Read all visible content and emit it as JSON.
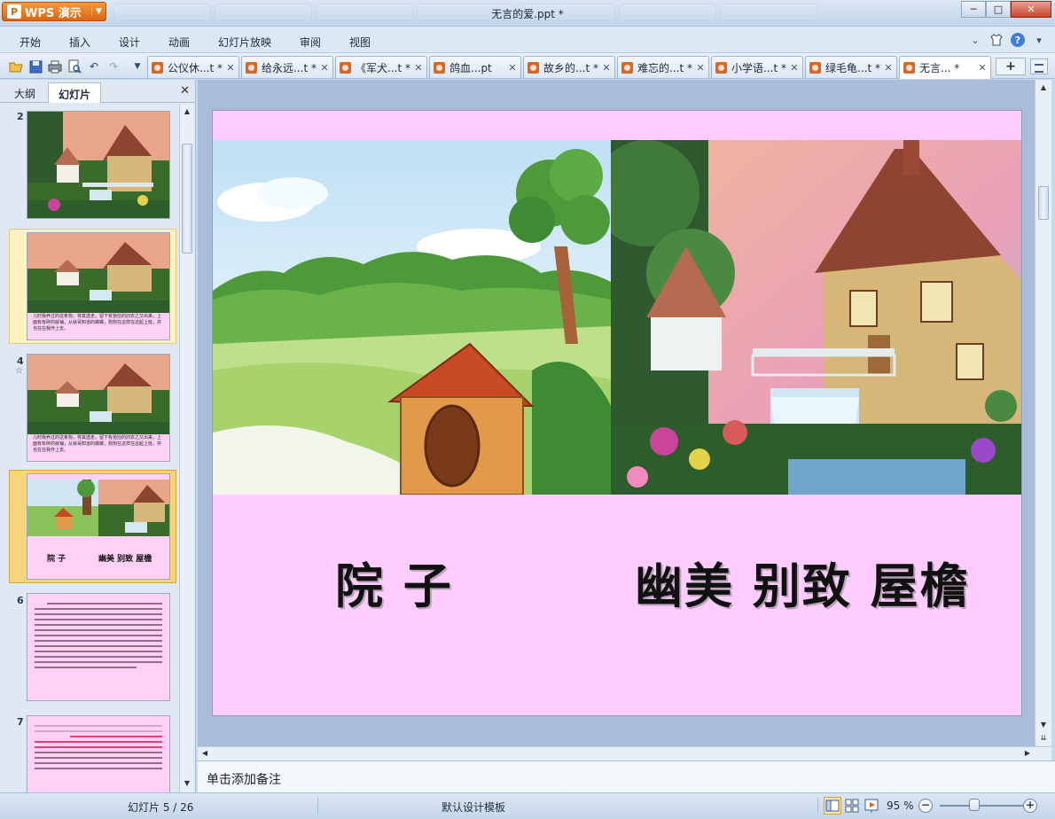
{
  "window": {
    "app_button_label": "WPS 演示",
    "title": "无言的爱.ppt *",
    "minimize": "─",
    "maximize": "□",
    "close": "✕"
  },
  "menu": {
    "items": [
      "开始",
      "插入",
      "设计",
      "动画",
      "幻灯片放映",
      "审阅",
      "视图"
    ]
  },
  "doc_tabs": [
    {
      "label": "公仪休...t *",
      "close": "✕"
    },
    {
      "label": "给永远...t *",
      "close": "✕"
    },
    {
      "label": "《军犬...t *",
      "close": "✕"
    },
    {
      "label": "鸽血...pt",
      "close": "✕"
    },
    {
      "label": "故乡的...t *",
      "close": "✕"
    },
    {
      "label": "难忘的...t *",
      "close": "✕"
    },
    {
      "label": "小学语...t *",
      "close": "✕"
    },
    {
      "label": "绿毛龟...t *",
      "close": "✕"
    },
    {
      "label": "无言... *",
      "close": "✕"
    }
  ],
  "new_tab": "+",
  "left_pane": {
    "tab_outline": "大纲",
    "tab_slides": "幻灯片",
    "close": "✕",
    "thumbnails": [
      {
        "num": "2"
      },
      {
        "num": "3",
        "text": "儿时我养过的这条狗，将其送走，留下有拾捡的旧衣之又出来，上面有有碎的就铺，从就哥知道的蝶蝶，狗狗在这样在这起上班，并也在在我作上去。"
      },
      {
        "num": "4",
        "star": "☆",
        "text": "儿时我养过的这条狗，将其送走，留下有拾捡的旧衣之又出来，上面有有碎的就铺，从就哥知道的蝶蝶，狗狗在这样在这起上班，并也在在我作上去。"
      },
      {
        "num": "5",
        "cap_left": "院 子",
        "cap_right": "幽美 别致 屋檐"
      },
      {
        "num": "6"
      },
      {
        "num": "7"
      }
    ]
  },
  "slide": {
    "caption_left": "院 子",
    "caption_right": "幽美  别致  屋檐"
  },
  "notes_placeholder": "单击添加备注",
  "status": {
    "slide_counter": "幻灯片 5 / 26",
    "template": "默认设计模板",
    "zoom": "95 %",
    "zoom_out": "−",
    "zoom_in": "+"
  },
  "colors": {
    "slide_background": "#ffccff",
    "app_button": "#e77a20",
    "selected_thumbnail": "#f6d67c"
  }
}
